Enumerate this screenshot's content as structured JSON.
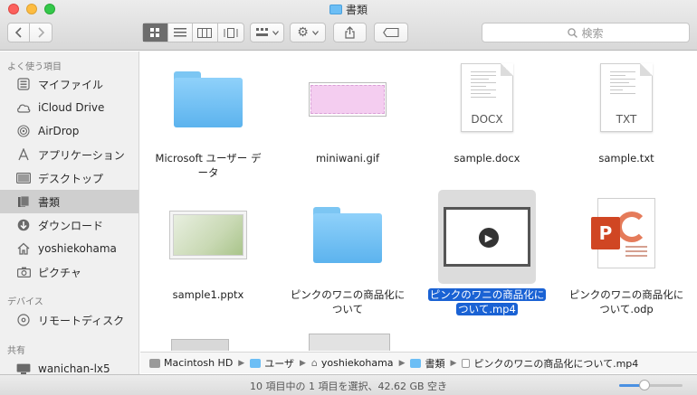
{
  "window": {
    "title": "書類"
  },
  "toolbar": {
    "back_icon": "chevron-left-icon",
    "forward_icon": "chevron-right-icon",
    "view_modes": [
      "icon",
      "list",
      "column",
      "cover-flow"
    ],
    "active_view": "icon",
    "group_icon": "group-icon",
    "action_icon": "gear-icon",
    "share_icon": "share-icon",
    "tags_icon": "tag-icon",
    "search_placeholder": "検索"
  },
  "sidebar": {
    "sections": [
      {
        "title": "よく使う項目",
        "items": [
          {
            "label": "マイファイル",
            "icon": "all-files-icon"
          },
          {
            "label": "iCloud Drive",
            "icon": "cloud-icon"
          },
          {
            "label": "AirDrop",
            "icon": "airdrop-icon"
          },
          {
            "label": "アプリケーション",
            "icon": "applications-icon"
          },
          {
            "label": "デスクトップ",
            "icon": "desktop-icon"
          },
          {
            "label": "書類",
            "icon": "documents-icon",
            "selected": true
          },
          {
            "label": "ダウンロード",
            "icon": "download-icon"
          },
          {
            "label": "yoshiekohama",
            "icon": "home-icon"
          },
          {
            "label": "ピクチャ",
            "icon": "camera-icon"
          }
        ]
      },
      {
        "title": "デバイス",
        "items": [
          {
            "label": "リモートディスク",
            "icon": "disc-icon"
          }
        ]
      },
      {
        "title": "共有",
        "items": [
          {
            "label": "wanichan-lx5",
            "icon": "display-icon"
          }
        ]
      }
    ]
  },
  "files": [
    {
      "name_line1": "Microsoft ユーザー デ",
      "name_line2": "ータ",
      "kind": "folder"
    },
    {
      "name_line1": "miniwani.gif",
      "name_line2": "",
      "kind": "gif"
    },
    {
      "name_line1": "sample.docx",
      "name_line2": "",
      "kind": "doc",
      "ext": "DOCX"
    },
    {
      "name_line1": "sample.txt",
      "name_line2": "",
      "kind": "doc",
      "ext": "TXT"
    },
    {
      "name_line1": "sample1.pptx",
      "name_line2": "",
      "kind": "pptx"
    },
    {
      "name_line1": "ピンクのワニの商品化に",
      "name_line2": "ついて",
      "kind": "folder"
    },
    {
      "name_line1": "ピンクのワニの商品化に",
      "name_line2": "ついて.mp4",
      "kind": "video",
      "selected": true
    },
    {
      "name_line1": "ピンクのワニの商品化に",
      "name_line2": "ついて.odp",
      "kind": "odp"
    }
  ],
  "pathbar": {
    "crumbs": [
      "Macintosh HD",
      "ユーザ",
      "yoshiekohama",
      "書類",
      "ピンクのワニの商品化について.mp4"
    ]
  },
  "status": {
    "text": "10 項目中の 1 項目を選択、42.62 GB 空き",
    "zoom_level": 0.4
  }
}
